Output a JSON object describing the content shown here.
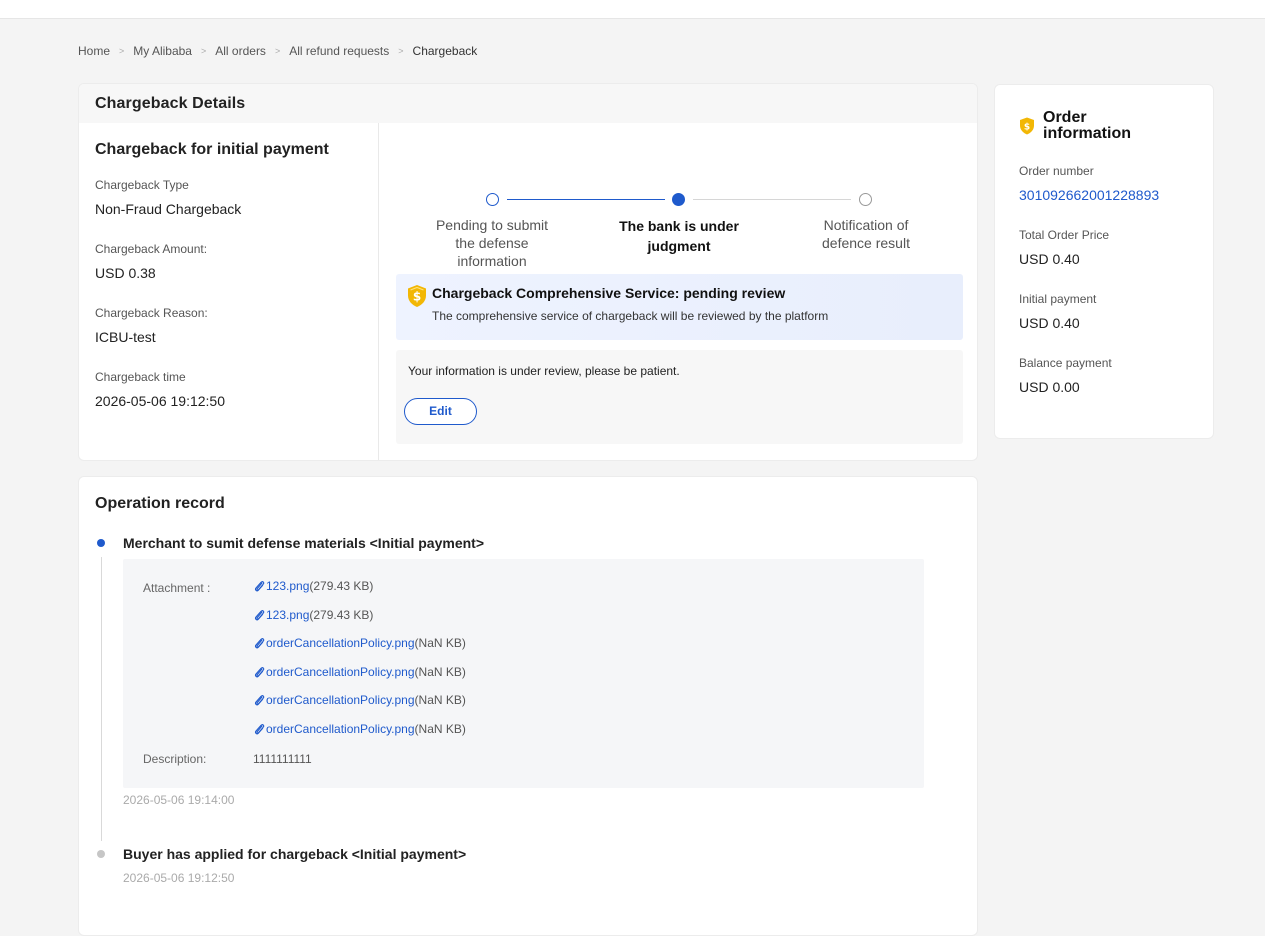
{
  "breadcrumb": {
    "items": [
      "Home",
      "My Alibaba",
      "All orders",
      "All refund requests",
      "Chargeback"
    ],
    "separator": ">"
  },
  "details": {
    "header": "Chargeback Details",
    "subtitle": "Chargeback for initial payment",
    "fields": [
      {
        "label": "Chargeback Type",
        "value": "Non-Fraud Chargeback"
      },
      {
        "label": "Chargeback Amount:",
        "value": "USD 0.38"
      },
      {
        "label": "Chargeback Reason:",
        "value": "ICBU-test"
      },
      {
        "label": "Chargeback time",
        "value": "2026-05-06 19:12:50"
      }
    ],
    "steps": [
      {
        "label": "Pending to submit the defense information",
        "state": "done"
      },
      {
        "label": "The bank is under judgment",
        "state": "current"
      },
      {
        "label": "Notification of defence result",
        "state": "pending"
      }
    ],
    "service": {
      "title": "Chargeback Comprehensive Service:  pending review",
      "description": "The comprehensive service of chargeback will be reviewed by the platform",
      "icon": "shield-coin-icon"
    },
    "review": {
      "message": "Your information is under review, please be patient.",
      "edit_label": "Edit"
    }
  },
  "order": {
    "title": "Order information",
    "icon": "shield-coin-icon",
    "fields": [
      {
        "label": "Order number",
        "value": "301092662001228893"
      },
      {
        "label": "Total Order Price",
        "value": "USD 0.40"
      },
      {
        "label": "Initial payment",
        "value": "USD 0.40"
      },
      {
        "label": "Balance payment",
        "value": "USD 0.00"
      }
    ]
  },
  "record": {
    "title": "Operation record",
    "entries": [
      {
        "title": "Merchant to sumit defense materials  <Initial payment>",
        "attachment_label": "Attachment :",
        "attachments": [
          {
            "name": "123.png",
            "size": "(279.43 KB)"
          },
          {
            "name": "123.png",
            "size": "(279.43 KB)"
          },
          {
            "name": "orderCancellationPolicy.png",
            "size": "(NaN KB)"
          },
          {
            "name": "orderCancellationPolicy.png",
            "size": "(NaN KB)"
          },
          {
            "name": "orderCancellationPolicy.png",
            "size": "(NaN KB)"
          },
          {
            "name": "orderCancellationPolicy.png",
            "size": "(NaN KB)"
          }
        ],
        "description_label": "Description:",
        "description": "1111111111",
        "time": "2026-05-06 19:14:00"
      },
      {
        "title": "Buyer has applied for chargeback  <Initial payment>",
        "time": "2026-05-06 19:12:50"
      }
    ]
  },
  "colors": {
    "accent": "#1f5acc",
    "icon_gold": "#f2b705",
    "service_bg": "#eef3ff"
  }
}
